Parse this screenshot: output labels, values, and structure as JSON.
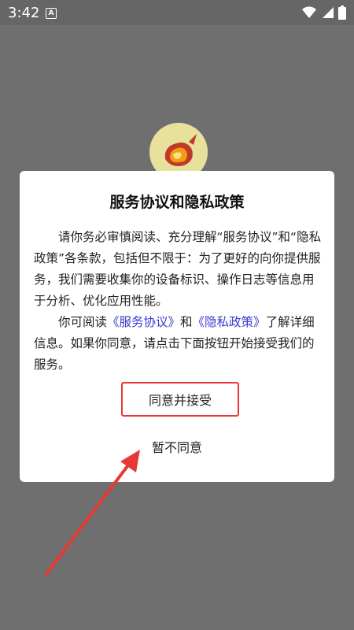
{
  "status_bar": {
    "time": "3:42",
    "notification_letter": "A"
  },
  "dialog": {
    "title": "服务协议和隐私政策",
    "paragraph1": "请你务必审慎阅读、充分理解“服务协议”和“隐私政策”各条款，包括但不限于：为了更好的向你提供服务，我们需要收集你的设备标识、操作日志等信息用于分析、优化应用性能。",
    "paragraph2_prefix": "你可阅读",
    "service_link": "《服务协议》",
    "and_text": "和",
    "privacy_link": "《隐私政策》",
    "paragraph2_suffix": "了解详细信息。如果你同意，请点击下面按钮开始接受我们的服务。",
    "agree_label": "同意并接受",
    "decline_label": "暂不同意"
  },
  "colors": {
    "overlay": "#6f6f6f",
    "link": "#3a3ad0",
    "highlight": "#e53935"
  },
  "icons": [
    "wifi-icon",
    "signal-icon",
    "battery-icon",
    "app-logo-icon"
  ]
}
